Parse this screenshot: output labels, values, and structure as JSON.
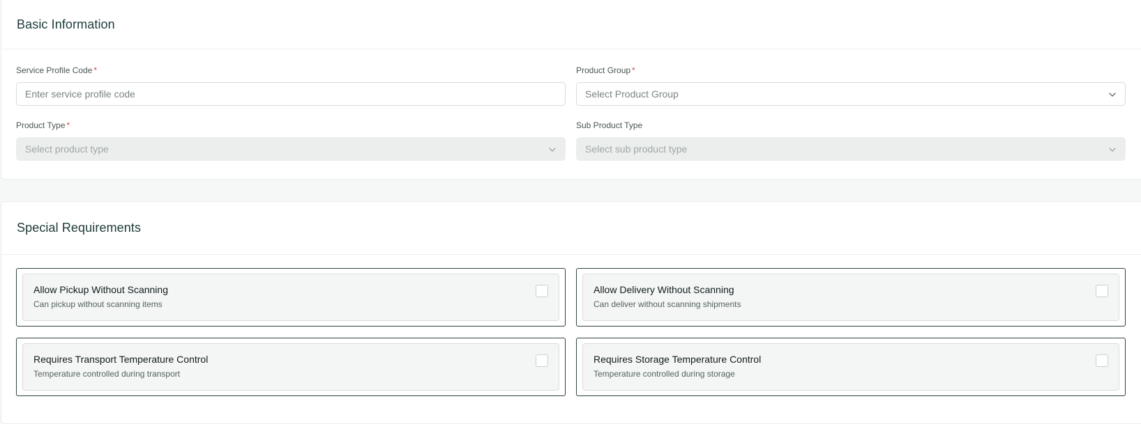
{
  "basic_information": {
    "title": "Basic Information",
    "service_profile_code": {
      "label": "Service Profile Code",
      "required_mark": "*",
      "placeholder": "Enter service profile code"
    },
    "product_group": {
      "label": "Product Group",
      "required_mark": "*",
      "placeholder": "Select Product Group",
      "icon": "chevron-down-icon"
    },
    "product_type": {
      "label": "Product Type",
      "required_mark": "*",
      "placeholder": "Select product type",
      "disabled": true,
      "icon": "chevron-down-icon"
    },
    "sub_product_type": {
      "label": "Sub Product Type",
      "placeholder": "Select sub product type",
      "disabled": true,
      "icon": "chevron-down-icon"
    }
  },
  "special_requirements": {
    "title": "Special Requirements",
    "items": [
      {
        "title": "Allow Pickup Without Scanning",
        "description": "Can pickup without scanning items",
        "checked": false
      },
      {
        "title": "Allow Delivery Without Scanning",
        "description": "Can deliver without scanning shipments",
        "checked": false
      },
      {
        "title": "Requires Transport Temperature Control",
        "description": "Temperature controlled during transport",
        "checked": false
      },
      {
        "title": "Requires Storage Temperature Control",
        "description": "Temperature controlled during storage",
        "checked": false
      }
    ]
  },
  "colors": {
    "required_mark": "#d64545",
    "section_title": "#1d3b39",
    "selected_border": "#2d4441",
    "disabled_fill": "#eceeee"
  }
}
